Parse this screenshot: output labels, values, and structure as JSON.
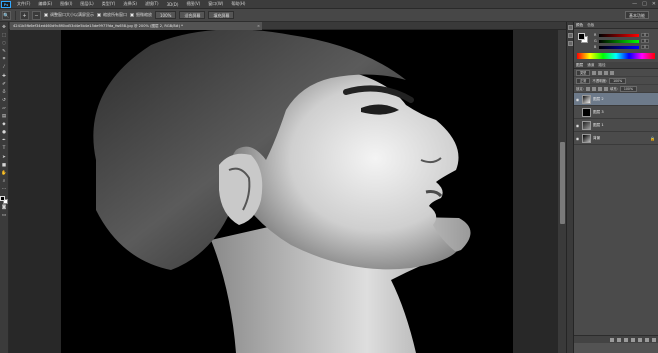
{
  "app": {
    "logo": "Ps",
    "menu": [
      "文件(F)",
      "编辑(E)",
      "图像(I)",
      "图层(L)",
      "类型(Y)",
      "选择(S)",
      "滤镜(T)",
      "3D(D)",
      "视图(V)",
      "窗口(W)",
      "帮助(H)"
    ],
    "window_controls": [
      "—",
      "□",
      "✕"
    ]
  },
  "options_bar": {
    "check_resize": "调整窗口大小以满屏显示",
    "check_all_windows": "缩放所有窗口",
    "check_scrubby": "细微缩放",
    "btn_100": "100%",
    "btn_fit": "适合屏幕",
    "btn_fill": "填充屏幕",
    "workspace": "基本功能"
  },
  "document": {
    "tab_title": "4241b5fb6ef34ed460d9c8f0bd53d4e5b4e15de9977fda_fw658.jpg @ 200% (图层 2, RGB/8#) *",
    "close_glyph": "×"
  },
  "color_panel": {
    "tabs": [
      "颜色",
      "色板"
    ],
    "fg": "#000000",
    "bg": "#ffffff",
    "sliders": [
      {
        "label": "R",
        "value": "0"
      },
      {
        "label": "G",
        "value": "0"
      },
      {
        "label": "B",
        "value": "0"
      }
    ]
  },
  "layers_panel": {
    "tabs": [
      "图层",
      "通道",
      "路径"
    ],
    "kind_label": "类型",
    "blend_mode": "正常",
    "opacity_label": "不透明度:",
    "opacity_value": "100%",
    "lock_label": "锁定:",
    "fill_label": "填充:",
    "fill_value": "100%",
    "layers": [
      {
        "name": "图层 2",
        "selected": true,
        "visible": true
      },
      {
        "name": "图层 3",
        "selected": false,
        "visible": false
      },
      {
        "name": "图层 1",
        "selected": false,
        "visible": true
      },
      {
        "name": "背景",
        "selected": false,
        "visible": true,
        "locked": true
      }
    ]
  }
}
